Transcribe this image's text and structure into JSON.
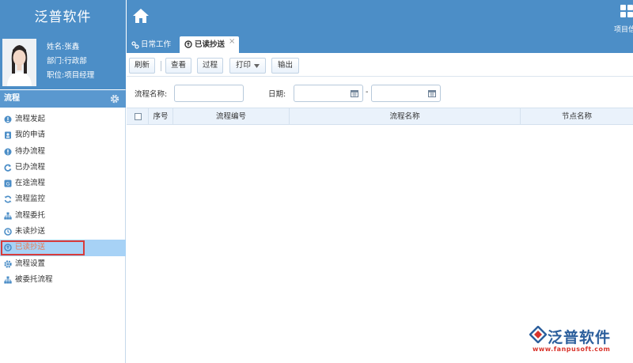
{
  "app": {
    "brand": "泛普软件",
    "project_label": "项目信"
  },
  "user": {
    "name_line": "姓名:张鑫",
    "dept_line": "部门:行政部",
    "title_line": "职位:项目经理"
  },
  "sidebar": {
    "section_title": "流程",
    "items": [
      {
        "label": "流程发起",
        "icon": "flow-start-icon"
      },
      {
        "label": "我的申请",
        "icon": "my-request-icon"
      },
      {
        "label": "待办流程",
        "icon": "todo-icon"
      },
      {
        "label": "已办流程",
        "icon": "done-icon"
      },
      {
        "label": "在途流程",
        "icon": "in-progress-icon"
      },
      {
        "label": "流程监控",
        "icon": "monitor-icon"
      },
      {
        "label": "流程委托",
        "icon": "delegate-icon"
      },
      {
        "label": "未读抄送",
        "icon": "unread-cc-icon"
      },
      {
        "label": "已读抄送",
        "icon": "read-cc-icon",
        "active": true
      },
      {
        "label": "流程设置",
        "icon": "settings-icon"
      },
      {
        "label": "被委托流程",
        "icon": "delegated-icon"
      }
    ]
  },
  "tabs": [
    {
      "label": "日常工作",
      "icon": "link-icon"
    },
    {
      "label": "已读抄送",
      "icon": "circle-arrow-icon",
      "active": true,
      "close": "×"
    }
  ],
  "toolbar": {
    "refresh": "刷新",
    "view": "查看",
    "process": "过程",
    "print": "打印",
    "export": "输出"
  },
  "filter": {
    "name_label": "流程名称:",
    "date_label": "日期:",
    "date_sep": "-",
    "name_value": "",
    "date_from": "",
    "date_to": ""
  },
  "table": {
    "columns": [
      "序号",
      "流程编号",
      "流程名称",
      "节点名称"
    ],
    "rows": []
  },
  "watermark": {
    "text": "泛普软件",
    "url": "www.fanpusoft.com"
  },
  "colors": {
    "header": "#4c8ec7",
    "active_row": "#a7d2f6",
    "active_text": "#e87b56",
    "highlight_border": "#d83b3b"
  }
}
